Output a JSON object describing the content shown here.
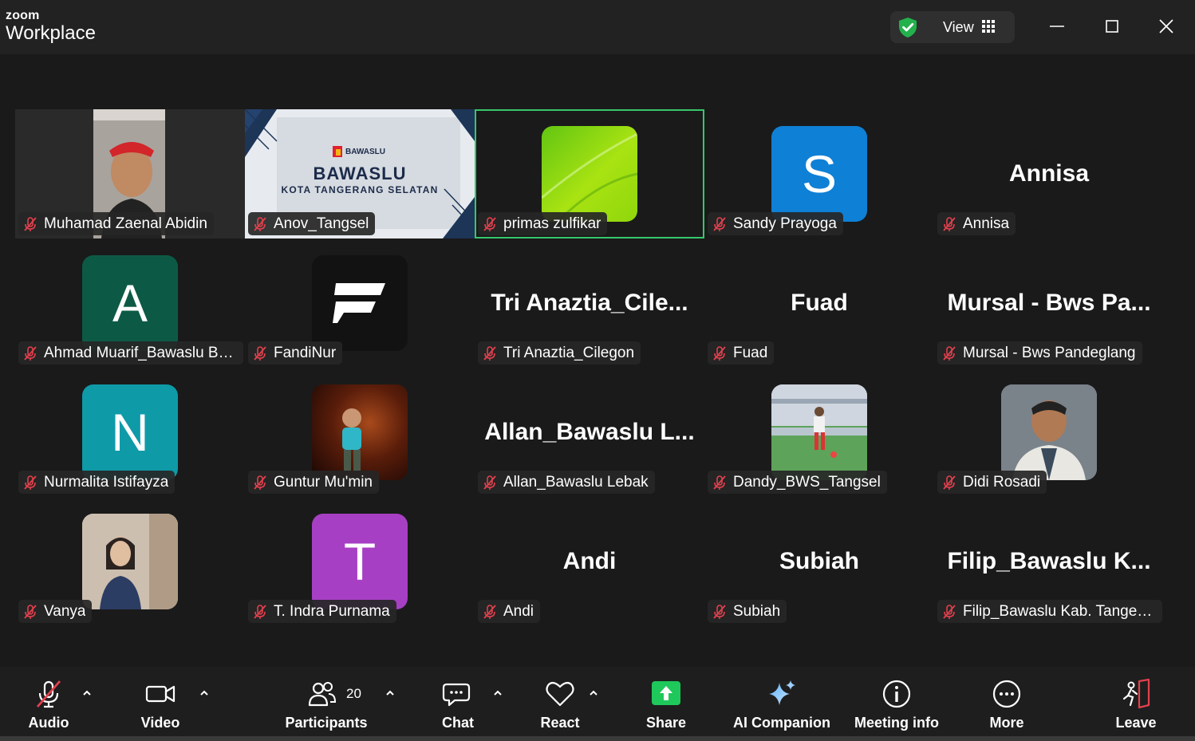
{
  "app": {
    "brand_top": "zoom",
    "brand_bottom": "Workplace",
    "view_label": "View",
    "colors": {
      "accent_green": "#36c76c",
      "muted_red": "#e3404d",
      "share_green": "#1ec85a"
    }
  },
  "participants": [
    {
      "name": "Muhamad Zaenal Abidin",
      "display": "photo",
      "muted": true
    },
    {
      "name": "Anov_Tangsel",
      "display": "banner",
      "muted": true,
      "banner_title": "BAWASLU",
      "banner_sub": "KOTA TANGERANG SELATAN",
      "banner_logo": "BAWASLU"
    },
    {
      "name": "primas zulfikar",
      "display": "green-gradient-avatar",
      "muted": true,
      "active_speaker": true
    },
    {
      "name": "Sandy Prayoga",
      "display": "letter",
      "letter": "S",
      "color": "#0e80d6",
      "muted": true
    },
    {
      "name": "Annisa",
      "display": "name",
      "big_name": "Annisa",
      "muted": true
    },
    {
      "name": "Ahmad Muarif_Bawaslu Ban...",
      "display": "letter",
      "letter": "A",
      "color": "#0c5a45",
      "muted": true
    },
    {
      "name": "FandiNur",
      "display": "logo",
      "muted": true
    },
    {
      "name": "Tri Anaztia_Cilegon",
      "display": "name",
      "big_name": "Tri  Anaztia_Cile...",
      "muted": true
    },
    {
      "name": "Fuad",
      "display": "name",
      "big_name": "Fuad",
      "muted": true
    },
    {
      "name": "Mursal - Bws Pandeglang",
      "display": "name",
      "big_name": "Mursal  -  Bws  Pa...",
      "muted": true
    },
    {
      "name": "Nurmalita Istifayza",
      "display": "letter",
      "letter": "N",
      "color": "#0f9aa8",
      "muted": true
    },
    {
      "name": "Guntur Mu'min",
      "display": "photo",
      "muted": true
    },
    {
      "name": "Allan_Bawaslu Lebak",
      "display": "name",
      "big_name": "Allan_Bawaslu  L...",
      "muted": true
    },
    {
      "name": "Dandy_BWS_Tangsel",
      "display": "photo",
      "muted": true
    },
    {
      "name": "Didi Rosadi",
      "display": "photo",
      "muted": true
    },
    {
      "name": "Vanya",
      "display": "photo",
      "muted": true
    },
    {
      "name": "T. Indra Purnama",
      "display": "letter",
      "letter": "T",
      "color": "#a73fc4",
      "muted": true
    },
    {
      "name": "Andi",
      "display": "name",
      "big_name": "Andi",
      "muted": true
    },
    {
      "name": "Subiah",
      "display": "name",
      "big_name": "Subiah",
      "muted": true
    },
    {
      "name": "Filip_Bawaslu Kab. Tangerang",
      "display": "name",
      "big_name": "Filip_Bawaslu  K...",
      "muted": true
    }
  ],
  "toolbar": {
    "audio": "Audio",
    "video": "Video",
    "participants": "Participants",
    "participants_count": "20",
    "chat": "Chat",
    "react": "React",
    "share": "Share",
    "ai_companion": "AI Companion",
    "meeting_info": "Meeting info",
    "more": "More",
    "leave": "Leave"
  }
}
